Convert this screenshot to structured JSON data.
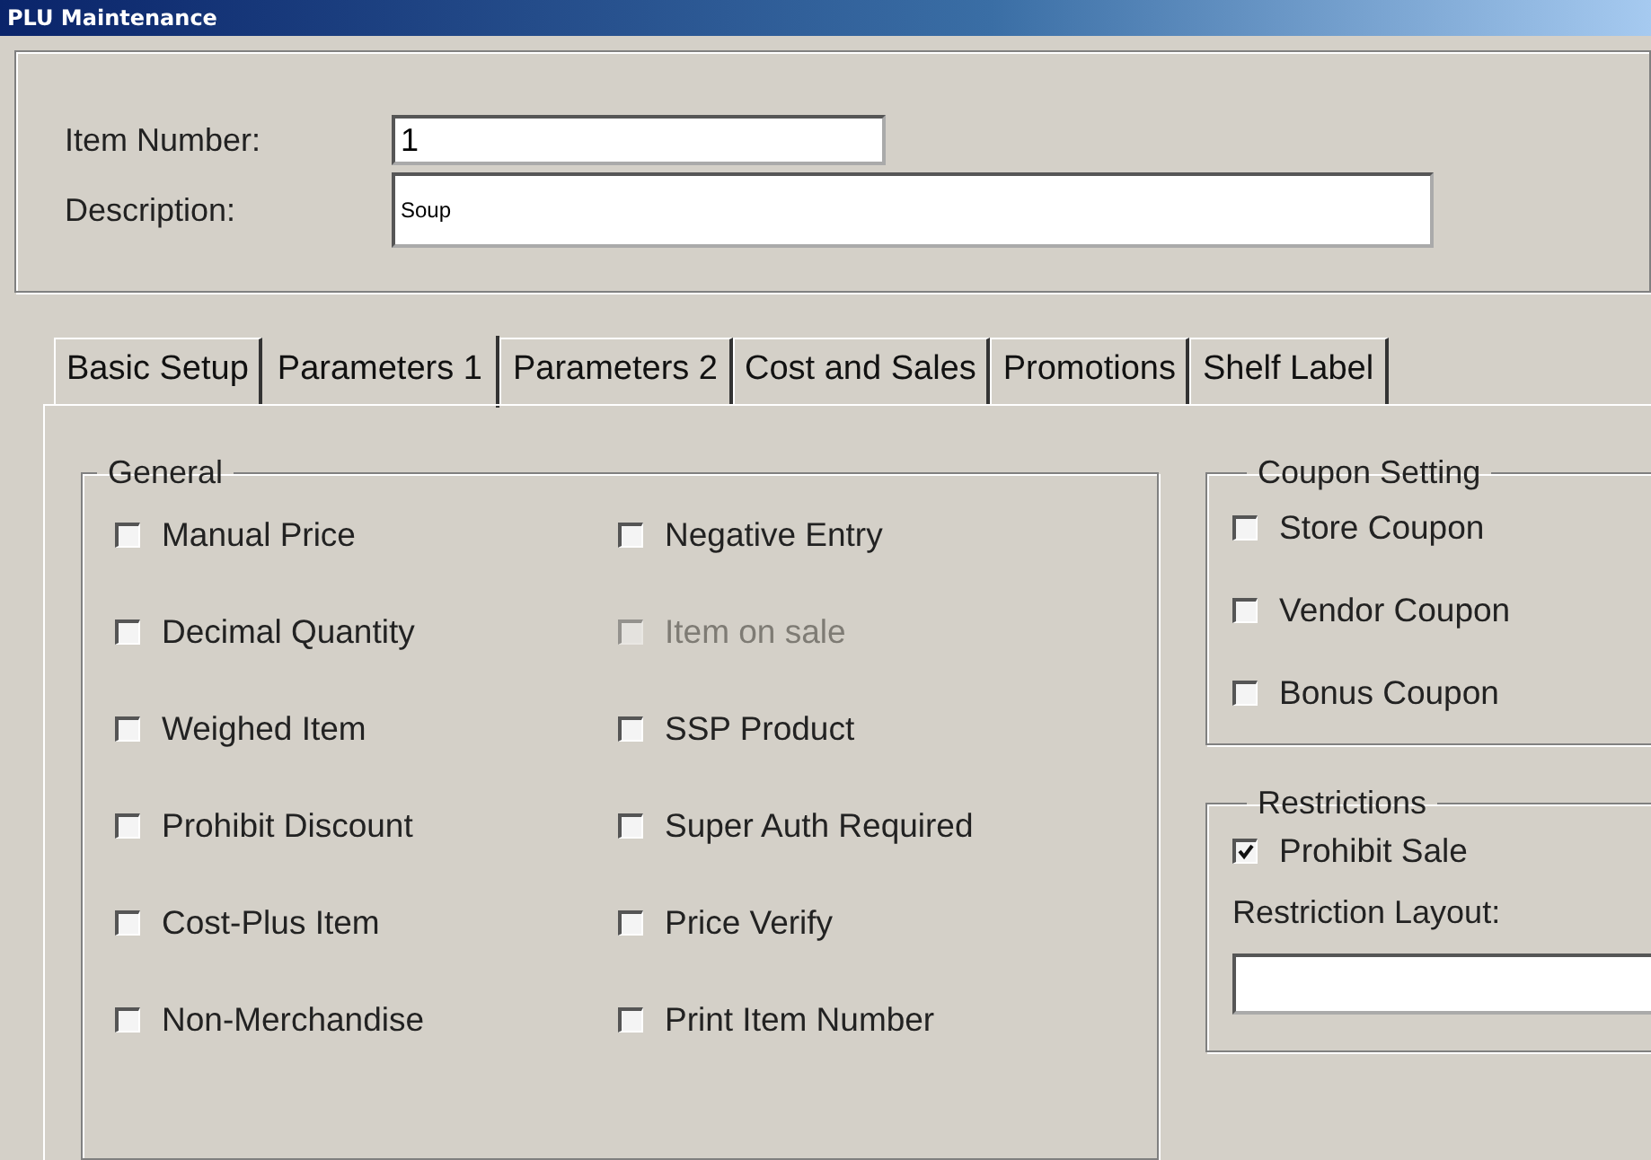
{
  "window": {
    "title": "PLU Maintenance"
  },
  "header": {
    "fields": [
      {
        "label": "Item Number:",
        "value": "1",
        "kind": "short"
      },
      {
        "label": "Description:",
        "value": "Soup",
        "kind": "long"
      }
    ]
  },
  "tabs": [
    {
      "label": "Basic Setup",
      "selected": false
    },
    {
      "label": "Parameters 1",
      "selected": true
    },
    {
      "label": "Parameters 2",
      "selected": false
    },
    {
      "label": "Cost and Sales",
      "selected": false
    },
    {
      "label": "Promotions",
      "selected": false
    },
    {
      "label": "Shelf Label",
      "selected": false
    }
  ],
  "general": {
    "title": "General",
    "columns": [
      [
        {
          "label": "Manual Price",
          "checked": false,
          "disabled": false
        },
        {
          "label": "Decimal Quantity",
          "checked": false,
          "disabled": false
        },
        {
          "label": "Weighed Item",
          "checked": false,
          "disabled": false
        },
        {
          "label": "Prohibit Discount",
          "checked": false,
          "disabled": false
        },
        {
          "label": "Cost-Plus Item",
          "checked": false,
          "disabled": false
        },
        {
          "label": "Non-Merchandise",
          "checked": false,
          "disabled": false
        }
      ],
      [
        {
          "label": "Negative Entry",
          "checked": false,
          "disabled": false
        },
        {
          "label": "Item on sale",
          "checked": false,
          "disabled": true
        },
        {
          "label": "SSP Product",
          "checked": false,
          "disabled": false
        },
        {
          "label": "Super Auth Required",
          "checked": false,
          "disabled": false
        },
        {
          "label": "Price Verify",
          "checked": false,
          "disabled": false
        },
        {
          "label": "Print Item Number",
          "checked": false,
          "disabled": false
        }
      ]
    ]
  },
  "coupon_setting": {
    "title": "Coupon Setting",
    "items": [
      {
        "label": "Store Coupon",
        "checked": false
      },
      {
        "label": "Vendor Coupon",
        "checked": false
      },
      {
        "label": "Bonus Coupon",
        "checked": false
      }
    ]
  },
  "restrictions": {
    "title": "Restrictions",
    "items": [
      {
        "label": "Prohibit Sale",
        "checked": true
      }
    ],
    "layout_label": "Restriction Layout:"
  }
}
